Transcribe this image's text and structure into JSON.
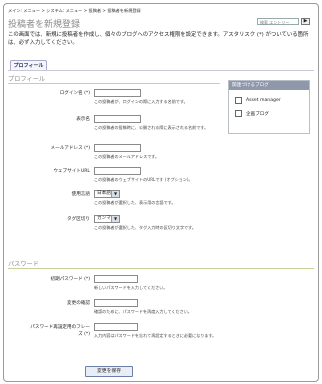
{
  "breadcrumb": "メイン: メニュー > システム: メニュー > 投稿者 > 投稿者を新規登録",
  "page_title": "投稿者を新規登録",
  "search": {
    "placeholder": "検索 エントリー",
    "button": "▶"
  },
  "intro": "この画面では、新規に投稿者を作成し、個々のブログへのアクセス権限を設定できます。アスタリスク (*) がついている箇所は、必ず入力してください。",
  "tab": "プロフィール",
  "profile": {
    "heading": "プロフィール",
    "fields": [
      {
        "label": "ログイン名 (*)",
        "help": "この投稿者が、ログインの際に入力する名前です。"
      },
      {
        "label": "表示名",
        "help": "この投稿者の投稿時に、公開される際に表示される名前です。"
      },
      {
        "label": "メールアドレス (*)",
        "help": "この投稿者のメールアドレスです。"
      },
      {
        "label": "ウェブサイトURL",
        "help": "この投稿者のウェブサイトのURLです (オプション)。"
      },
      {
        "label": "使用言語",
        "value": "日本語",
        "help": "この投稿者が選択した、表示用の言語です。"
      },
      {
        "label": "タグ区切り",
        "value": "カンマ",
        "help": "この投稿者が選択した、タグ入力時の区切り文字です。"
      }
    ]
  },
  "blog_box": {
    "heading": "関連づけるブログ",
    "items": [
      "Asset manager",
      "企画ブログ"
    ]
  },
  "password": {
    "heading": "パスワード",
    "fields": [
      {
        "label": "初期パスワード (*)",
        "help": "新しいパスワードを入力してください。"
      },
      {
        "label": "変更の確認",
        "help": "確認のために、パスワードを再度入力してください。"
      },
      {
        "label": "パスワード再設定用のフレーズ (*)",
        "help": "入力内容はパスワードを忘れて再設定するときに必要になります。"
      }
    ]
  },
  "save_label": "変更を保存"
}
